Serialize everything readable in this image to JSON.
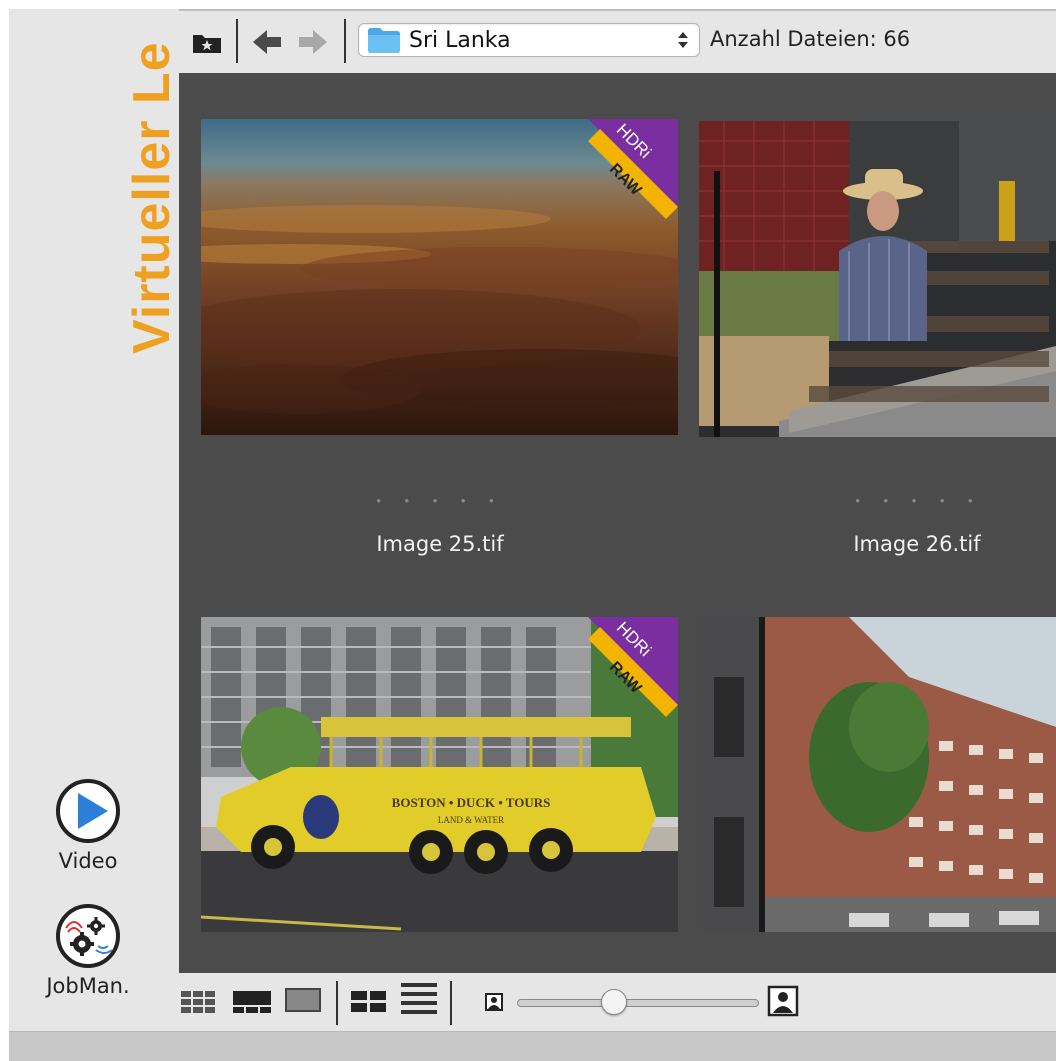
{
  "sidebar": {
    "title": "Virtueller Le",
    "title_color": "#f0a020",
    "video_label": "Video",
    "jobman_label": "JobMan."
  },
  "toolbar": {
    "folder_name": "Sri Lanka",
    "file_count_label": "Anzahl Dateien: 66",
    "icons": [
      "favorites-folder-icon",
      "back-arrow-icon",
      "forward-arrow-icon",
      "folder-icon",
      "updown-chevron-icon"
    ]
  },
  "grid": {
    "items": [
      {
        "filename": "Image 25.tif",
        "rating_dots": "• • • • •",
        "badge_top": "HDRi",
        "badge_bottom": "RAW"
      },
      {
        "filename": "Image 26.tif",
        "rating_dots": "• • • • •"
      },
      {
        "filename": "",
        "badge_top": "HDRi",
        "badge_bottom": "RAW",
        "bus_text": "BOSTON • DUCK • TOURS",
        "bus_sub": "LAND & WATER"
      },
      {
        "filename": ""
      }
    ]
  },
  "bottombar": {
    "views": [
      "grid-small-view-icon",
      "filmstrip-view-icon",
      "single-view-icon",
      "grid-large-view-icon",
      "list-view-icon"
    ],
    "thumbnail_size": 0.4
  },
  "colors": {
    "accent": "#f0a020",
    "grid_bg": "#4b4b4b",
    "badge_purple": "#7a2ea0",
    "badge_yellow": "#f2b400",
    "play_blue": "#2b7fd8"
  }
}
